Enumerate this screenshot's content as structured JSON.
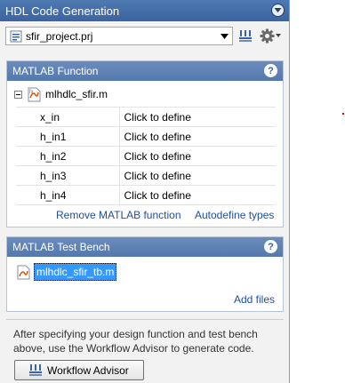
{
  "window": {
    "title": "HDL Code Generation"
  },
  "toolbar": {
    "project_file": "sfir_project.prj",
    "build_icon": "build-icon",
    "settings_icon": "gear-icon"
  },
  "matlab_function": {
    "header": "MATLAB Function",
    "function_name": "mlhdlc_sfir.m",
    "inputs": [
      {
        "name": "x_in",
        "value": "Click to define"
      },
      {
        "name": "h_in1",
        "value": "Click to define"
      },
      {
        "name": "h_in2",
        "value": "Click to define"
      },
      {
        "name": "h_in3",
        "value": "Click to define"
      },
      {
        "name": "h_in4",
        "value": "Click to define"
      }
    ],
    "remove_link": "Remove MATLAB function",
    "autodefine_link": "Autodefine types"
  },
  "test_bench": {
    "header": "MATLAB Test Bench",
    "file": "mlhdlc_sfir_tb.m",
    "add_files_link": "Add files"
  },
  "footer": {
    "text": "After specifying your design function and test bench above, use the Workflow Advisor to generate code.",
    "workflow_button": "Workflow Advisor"
  },
  "colors": {
    "titlebar": "#3b64a0",
    "section_header": "#5578ad",
    "link": "#1f4f9a",
    "selection": "#3399ff"
  }
}
